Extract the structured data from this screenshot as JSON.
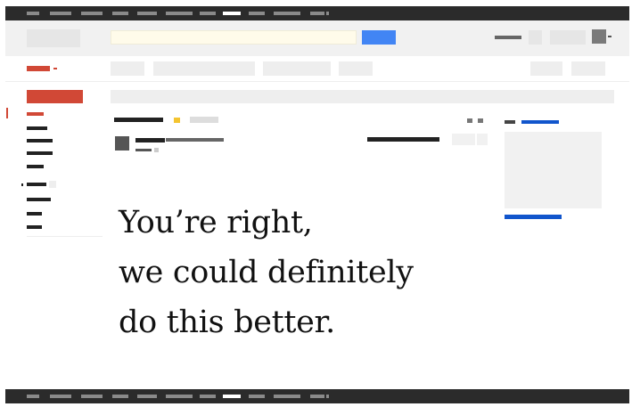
{
  "headline": {
    "lines": [
      "You’re right,",
      "we could definitely",
      "do this better."
    ]
  },
  "colors": {
    "top_bar": "#2b2b2b",
    "header_band": "#f1f1f1",
    "search_field": "#fffbea",
    "search_button": "#4285f4",
    "compose_button": "#d14836",
    "accent_blue": "#1155cc",
    "placeholder_gray": "#e5e5e5",
    "placeholder_dark": "#222222"
  }
}
